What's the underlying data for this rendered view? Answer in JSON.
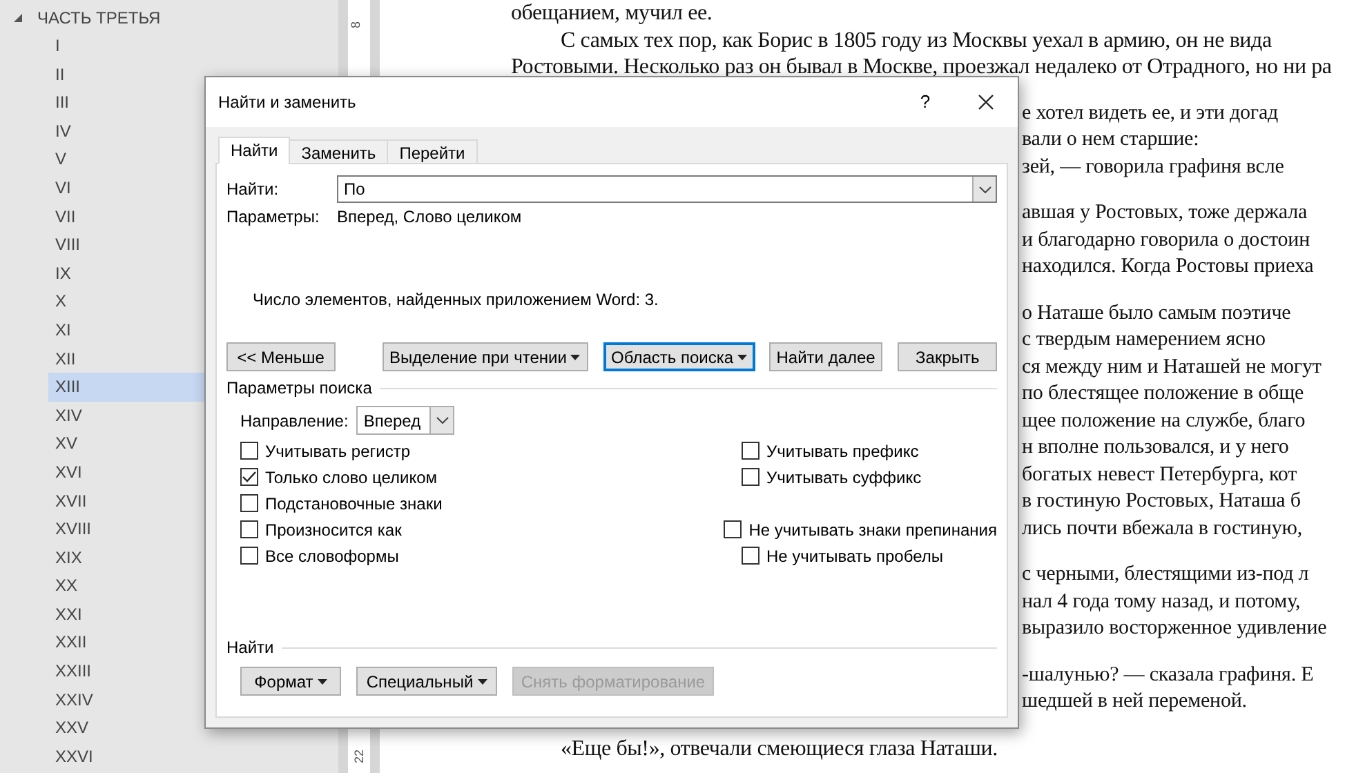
{
  "navigation": {
    "heading": {
      "label": "ЧАСТЬ ТРЕТЬЯ",
      "expanded": true,
      "children": [
        {
          "label": "I",
          "selected": false
        },
        {
          "label": "II",
          "selected": false
        },
        {
          "label": "III",
          "selected": false
        },
        {
          "label": "IV",
          "selected": false
        },
        {
          "label": "V",
          "selected": false
        },
        {
          "label": "VI",
          "selected": false
        },
        {
          "label": "VII",
          "selected": false
        },
        {
          "label": "VIII",
          "selected": false
        },
        {
          "label": "IX",
          "selected": false
        },
        {
          "label": "X",
          "selected": false
        },
        {
          "label": "XI",
          "selected": false
        },
        {
          "label": "XII",
          "selected": false
        },
        {
          "label": "XIII",
          "selected": true
        },
        {
          "label": "XIV",
          "selected": false
        },
        {
          "label": "XV",
          "selected": false
        },
        {
          "label": "XVI",
          "selected": false
        },
        {
          "label": "XVII",
          "selected": false
        },
        {
          "label": "XVIII",
          "selected": false
        },
        {
          "label": "XIX",
          "selected": false
        },
        {
          "label": "XX",
          "selected": false
        },
        {
          "label": "XXI",
          "selected": false
        },
        {
          "label": "XXII",
          "selected": false
        },
        {
          "label": "XXIII",
          "selected": false
        },
        {
          "label": "XXIV",
          "selected": false
        },
        {
          "label": "XXV",
          "selected": false
        },
        {
          "label": "XXVI",
          "selected": false
        }
      ]
    }
  },
  "ruler": {
    "labels": [
      "8",
      "22"
    ]
  },
  "document": {
    "paragraphs": [
      {
        "lines": [
          {
            "kind": "full",
            "text": "обещанием, мучил ее."
          },
          {
            "kind": "indent",
            "text": "С самых тех пор, как Борис в 1805 году из Москвы уехал в армию, он не вида"
          },
          {
            "kind": "full",
            "text": "Ростовыми. Несколько раз он бывал в Москве, проезжал недалеко от Отрадного, но ни ра"
          }
        ]
      },
      {
        "lines": [
          {
            "kind": "fragment",
            "text": "е хотел видеть ее, и эти догад"
          },
          {
            "kind": "fragment",
            "text": "вали о нем старшие:"
          },
          {
            "kind": "fragment",
            "text": "зей, — говорила графиня всле"
          }
        ]
      },
      {
        "lines": [
          {
            "kind": "fragment",
            "text": "авшая у Ростовых, тоже держала"
          },
          {
            "kind": "fragment",
            "text": "и благодарно говорила о достоин"
          },
          {
            "kind": "fragment",
            "text": "находился. Когда Ростовы приеха"
          }
        ]
      },
      {
        "lines": [
          {
            "kind": "fragment",
            "text": "о Наташе было самым поэтиче"
          },
          {
            "kind": "fragment",
            "text": "с твердым намерением ясно"
          },
          {
            "kind": "fragment",
            "text": "ся между ним и Наташей не могут"
          },
          {
            "kind": "fragment",
            "text": "по блестящее положение в обще"
          },
          {
            "kind": "fragment",
            "text": "щее положение на службе, благо"
          },
          {
            "kind": "fragment",
            "text": "н вполне пользовался, и у него"
          },
          {
            "kind": "fragment",
            "text": "богатых невест Петербурга, кот"
          },
          {
            "kind": "fragment",
            "text": "в гостиную Ростовых, Наташа б"
          },
          {
            "kind": "fragment",
            "text": "лись почти вбежала в гостиную,"
          }
        ]
      },
      {
        "lines": [
          {
            "kind": "fragment",
            "text": "с черными, блестящими из-под л"
          },
          {
            "kind": "fragment",
            "text": "нал 4 года тому назад, и потому,"
          },
          {
            "kind": "fragment",
            "text": "выразило восторженное удивление"
          }
        ]
      },
      {
        "lines": [
          {
            "kind": "fragment",
            "text": "-шалунью? — сказала графиня. Е"
          },
          {
            "kind": "fragment",
            "text": "шедшей в ней переменой."
          }
        ]
      },
      {
        "lines": [
          {
            "kind": "indent",
            "text": "«Еще бы!», отвечали смеющиеся глаза Наташи."
          }
        ]
      }
    ]
  },
  "dialog": {
    "title": "Найти и заменить",
    "help": "?",
    "tabs": [
      {
        "label": "Найти",
        "selected": true
      },
      {
        "label": "Заменить",
        "selected": false
      },
      {
        "label": "Перейти",
        "selected": false
      }
    ],
    "find": {
      "label": "Найти:",
      "value": "По"
    },
    "parameters": {
      "label": "Параметры:",
      "value": "Вперед, Слово целиком"
    },
    "message": "Число элементов, найденных приложением Word: 3.",
    "buttons": [
      {
        "label": "<< Меньше",
        "kind": "push",
        "focused": false
      },
      {
        "label": "Выделение при чтении",
        "kind": "menu",
        "focused": false
      },
      {
        "label": "Область поиска",
        "kind": "menu",
        "focused": true
      },
      {
        "label": "Найти далее",
        "kind": "push",
        "focused": false
      },
      {
        "label": "Закрыть",
        "kind": "push",
        "focused": false
      }
    ],
    "search_options": {
      "heading": "Параметры поиска",
      "direction": {
        "label": "Направление:",
        "value": "Вперед"
      },
      "rows": [
        {
          "left": {
            "label": "Учитывать регистр",
            "checked": false
          },
          "right": {
            "label": "Учитывать префикс",
            "checked": false
          }
        },
        {
          "left": {
            "label": "Только слово целиком",
            "checked": true
          },
          "right": {
            "label": "Учитывать суффикс",
            "checked": false
          }
        },
        {
          "left": {
            "label": "Подстановочные знаки",
            "checked": false
          }
        },
        {
          "left": {
            "label": "Произносится как",
            "checked": false
          },
          "right": {
            "label": "Не учитывать знаки препинания",
            "checked": false
          }
        },
        {
          "left": {
            "label": "Все словоформы",
            "checked": false
          },
          "right": {
            "label": "Не учитывать пробелы",
            "checked": false
          }
        }
      ]
    },
    "format_section": {
      "heading": "Найти",
      "buttons": [
        {
          "label": "Формат",
          "kind": "menu",
          "disabled": false
        },
        {
          "label": "Специальный",
          "kind": "menu",
          "disabled": false
        },
        {
          "label": "Снять форматирование",
          "kind": "push",
          "disabled": true
        }
      ]
    }
  }
}
